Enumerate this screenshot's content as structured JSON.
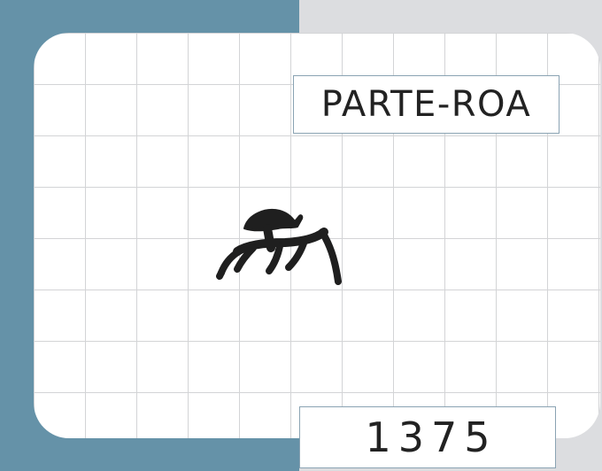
{
  "card": {
    "label": "PARTE-ROA",
    "number": "1375",
    "glyph_icon": "petroglyph-animal-icon"
  },
  "colors": {
    "background": "#dcdde0",
    "accent_block": "#6592a8",
    "card": "#ffffff",
    "grid_lines": "#d3d4d6",
    "box_border": "#8aa3b3",
    "ink": "#222222"
  }
}
